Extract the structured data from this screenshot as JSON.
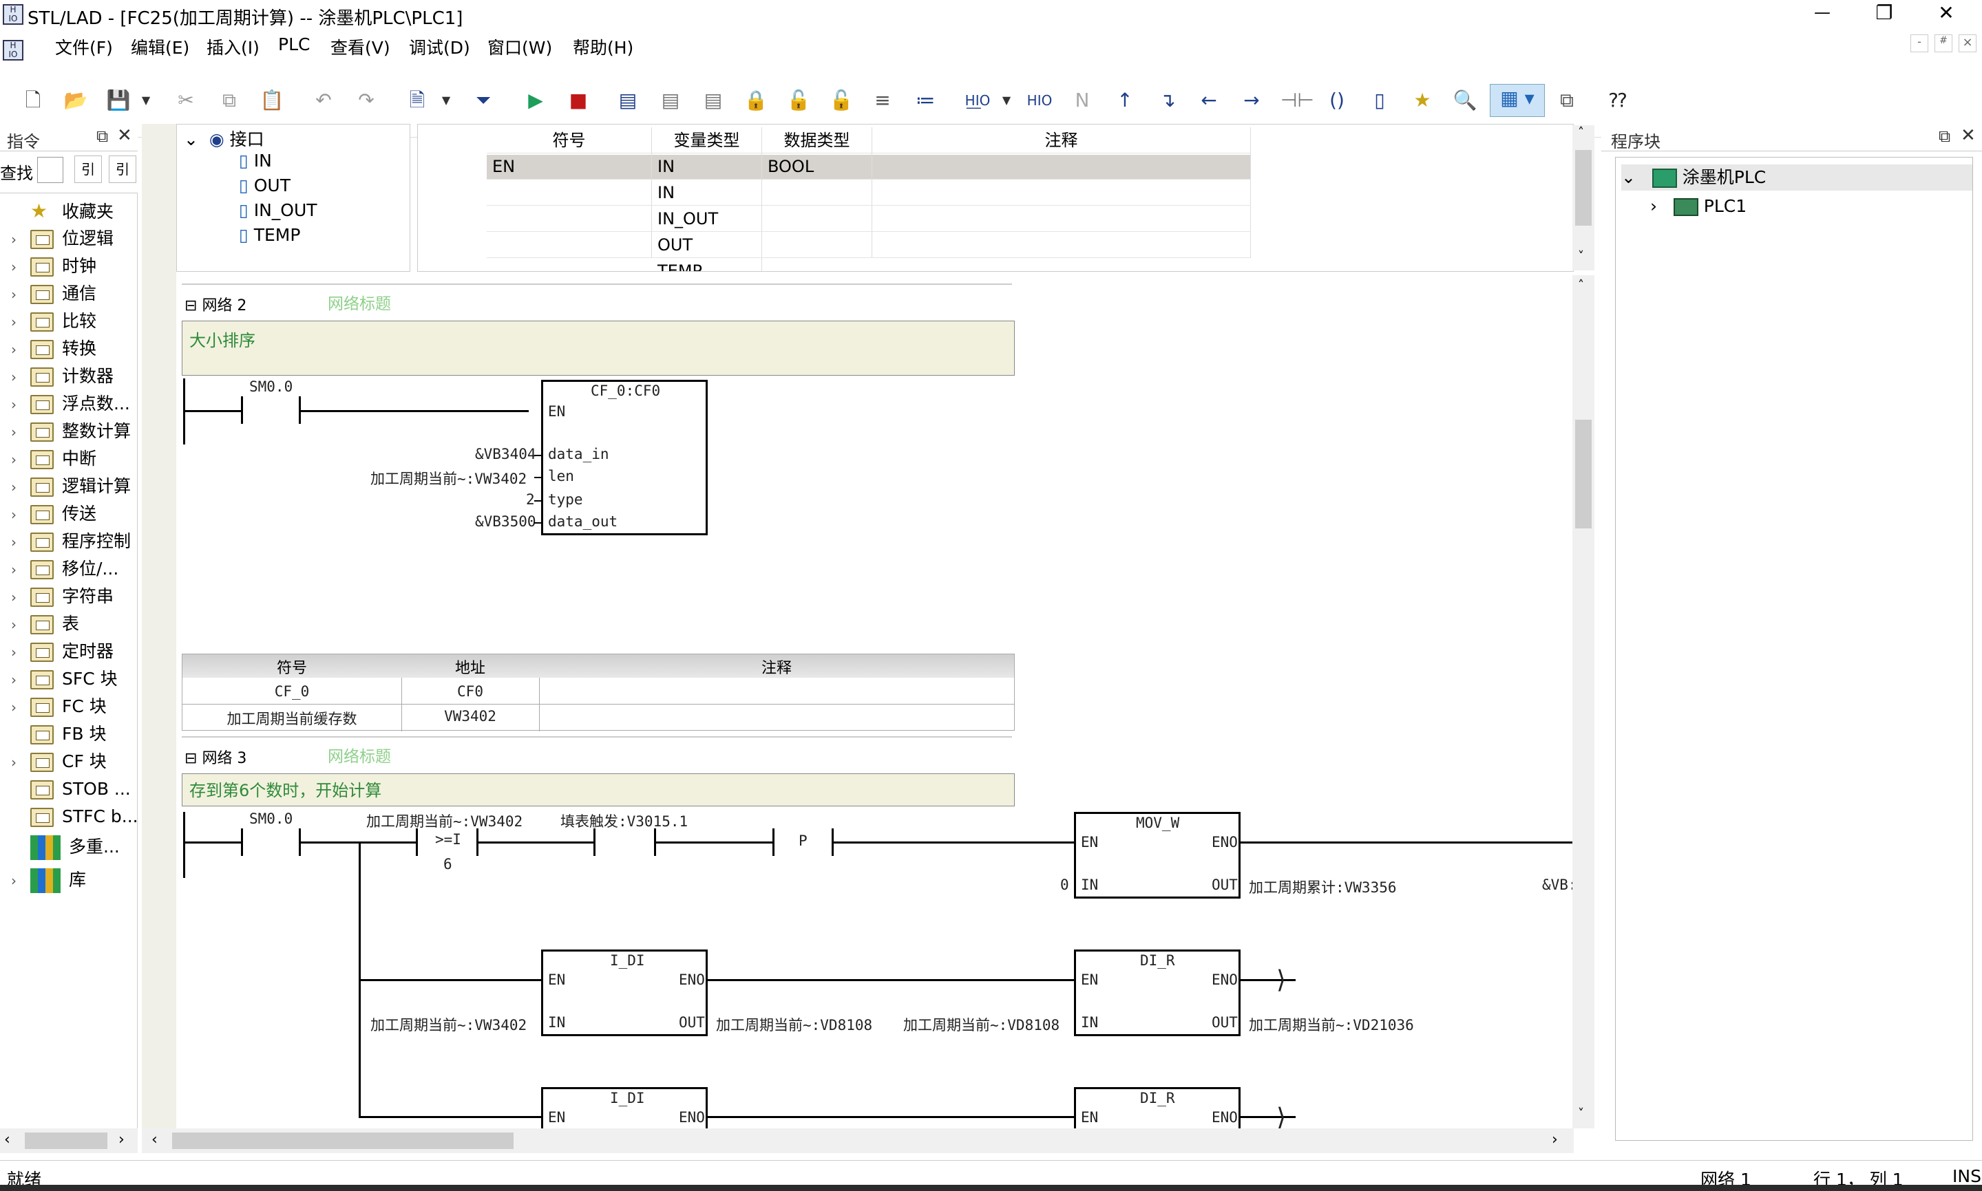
{
  "window": {
    "title": "STL/LAD - [FC25(加工周期计算) -- 涂墨机PLC\\PLC1]",
    "minimize": "—",
    "restore": "❐",
    "close": "✕",
    "sub_min": "-",
    "sub_restore": "#",
    "sub_close": "×"
  },
  "menu": [
    "文件(F)",
    "编辑(E)",
    "插入(I)",
    "PLC",
    "查看(V)",
    "调试(D)",
    "窗口(W)",
    "帮助(H)"
  ],
  "instructions_panel": {
    "title": "指令",
    "search_label": "查找",
    "search_value": "",
    "btn1": "引",
    "btn2": "引",
    "items": [
      "收藏夹",
      "位逻辑",
      "时钟",
      "通信",
      "比较",
      "转换",
      "计数器",
      "浮点数...",
      "整数计算",
      "中断",
      "逻辑计算",
      "传送",
      "程序控制",
      "移位/...",
      "字符串",
      "表",
      "定时器",
      "SFC 块",
      "FC 块",
      "FB 块",
      "CF 块",
      "STOB ...",
      "STFC b...",
      "多重...",
      "库"
    ]
  },
  "interface_tree": {
    "root": "接口",
    "children": [
      "IN",
      "OUT",
      "IN_OUT",
      "TEMP"
    ]
  },
  "interface_table": {
    "headers": [
      "符号",
      "变量类型",
      "数据类型",
      "注释"
    ],
    "rows": [
      [
        "EN",
        "IN",
        "BOOL",
        ""
      ],
      [
        "",
        "IN",
        "",
        ""
      ],
      [
        "",
        "IN_OUT",
        "",
        ""
      ],
      [
        "",
        "OUT",
        "",
        ""
      ],
      [
        "",
        "TEMP",
        "",
        ""
      ]
    ]
  },
  "network2": {
    "label": "网络 2",
    "title_placeholder": "网络标题",
    "comment": "大小排序",
    "contact": "SM0.0",
    "block_name": "CF_0:CF0",
    "en": "EN",
    "params": [
      {
        "arg": "&VB3404",
        "pin": "data_in"
      },
      {
        "arg": "加工周期当前~:VW3402",
        "pin": "len"
      },
      {
        "arg": "2",
        "pin": "type"
      },
      {
        "arg": "&VB3500",
        "pin": "data_out"
      }
    ],
    "symbol_table": {
      "headers": [
        "符号",
        "地址",
        "注释"
      ],
      "rows": [
        [
          "CF_0",
          "CF0",
          ""
        ],
        [
          "加工周期当前缓存数",
          "VW3402",
          ""
        ]
      ]
    }
  },
  "network3": {
    "label": "网络 3",
    "title_placeholder": "网络标题",
    "comment": "存到第6个数时，开始计算",
    "contact": "SM0.0",
    "compare_top": "加工周期当前~:VW3402",
    "compare_op": ">=I",
    "compare_bottom": "6",
    "trigger": "填表触发:V3015.1",
    "p_label": "P",
    "mov": {
      "name": "MOV_W",
      "en": "EN",
      "eno": "ENO",
      "in": "IN",
      "out": "OUT",
      "in_arg": "0",
      "out_arg": "加工周期累计:VW3356",
      "trail": "&VB:"
    },
    "idi1": {
      "name": "I_DI",
      "en": "EN",
      "eno": "ENO",
      "in": "IN",
      "out": "OUT",
      "in_arg": "加工周期当前~:VW3402",
      "out_arg": "加工周期当前~:VD8108"
    },
    "dir1": {
      "name": "DI_R",
      "en": "EN",
      "eno": "ENO",
      "in": "IN",
      "out": "OUT",
      "in_arg": "加工周期当前~:VD8108",
      "out_arg": "加工周期当前~:VD21036"
    },
    "idi2": {
      "name": "I_DI",
      "en": "EN",
      "eno": "ENO"
    },
    "dir2": {
      "name": "DI_R",
      "en": "EN",
      "eno": "ENO"
    }
  },
  "program_panel": {
    "title": "程序块",
    "project": "涂墨机PLC",
    "plc": "PLC1"
  },
  "status": {
    "left": "就绪",
    "network": "网络 1",
    "position": "行 1， 列 1",
    "mode": "INS"
  },
  "colors": {
    "accent": "#0078d7",
    "comment_bg": "#f2f1de",
    "comment_text": "#2e8b3a",
    "net_title": "#8fd08a"
  }
}
